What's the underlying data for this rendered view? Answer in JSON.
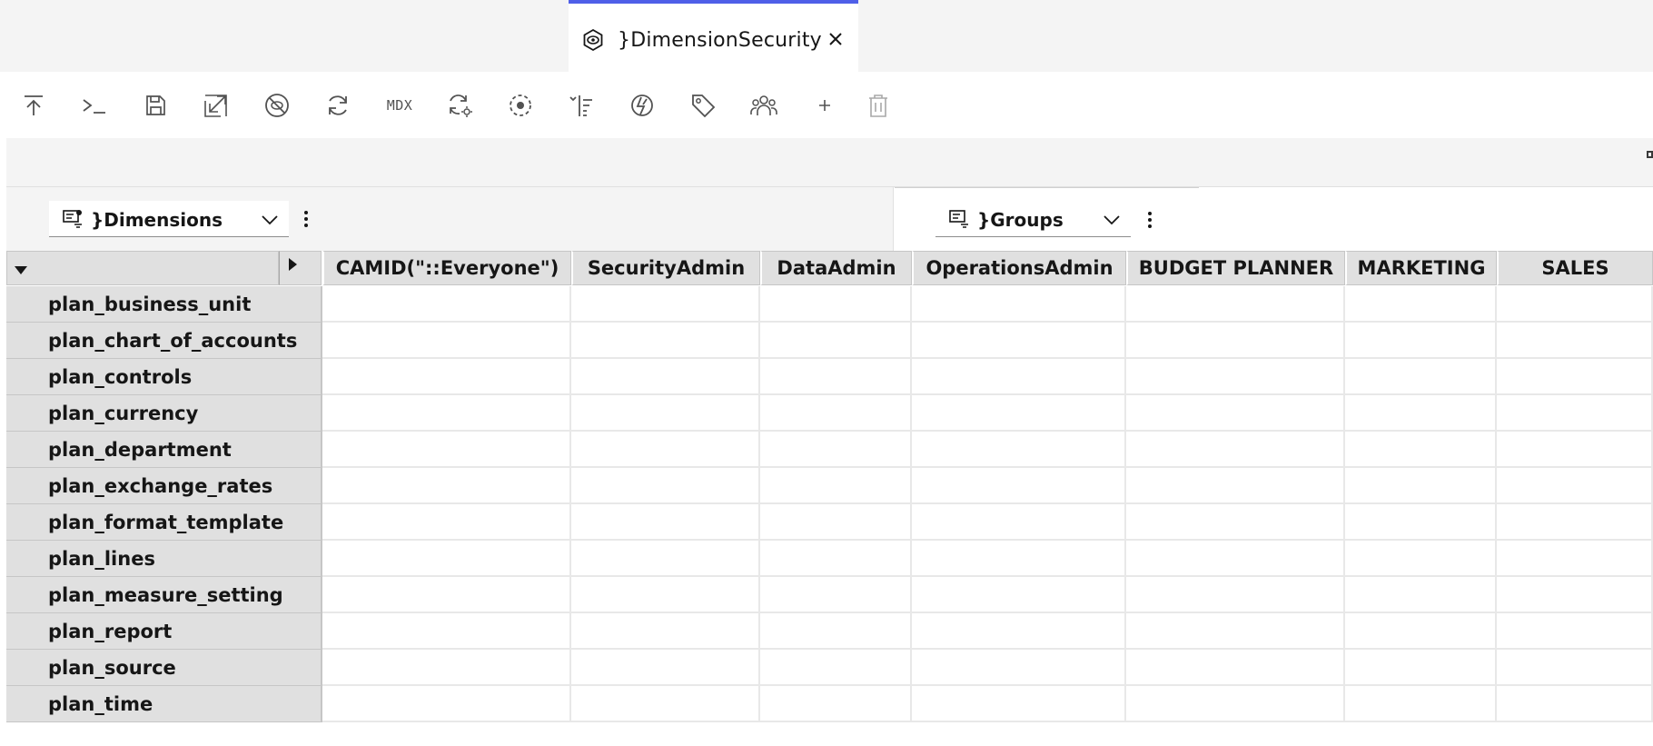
{
  "tab": {
    "title": "}DimensionSecurity",
    "icon": "view-icon",
    "accent_color": "#4f5fe8"
  },
  "toolbar": {
    "items": [
      {
        "name": "publish",
        "icon": "upload-icon"
      },
      {
        "name": "console",
        "icon": "terminal-icon"
      },
      {
        "name": "save",
        "icon": "save-icon"
      },
      {
        "name": "resize",
        "icon": "resize-icon"
      },
      {
        "name": "hide-empty",
        "icon": "no-view-icon"
      },
      {
        "name": "refresh",
        "icon": "refresh-icon"
      },
      {
        "name": "mdx",
        "label": "MDX"
      },
      {
        "name": "auto-refresh",
        "icon": "refresh-settings-icon"
      },
      {
        "name": "focus",
        "icon": "focus-icon"
      },
      {
        "name": "sort",
        "icon": "tree-sort-icon"
      },
      {
        "name": "no-zero",
        "icon": "zero-suppress-icon"
      },
      {
        "name": "tag",
        "icon": "tag-icon"
      },
      {
        "name": "users",
        "icon": "users-icon"
      },
      {
        "name": "add",
        "icon": "plus-icon"
      },
      {
        "name": "delete",
        "icon": "trash-icon"
      }
    ]
  },
  "selectors": {
    "rows": {
      "label": "}Dimensions",
      "icon": "subset-icon"
    },
    "columns": {
      "label": "}Groups",
      "icon": "subset-icon"
    }
  },
  "grid": {
    "columns": [
      "CAMID(\"::Everyone\")",
      "SecurityAdmin",
      "DataAdmin",
      "OperationsAdmin",
      "BUDGET PLANNER",
      "MARKETING",
      "SALES"
    ],
    "rows": [
      "plan_business_unit",
      "plan_chart_of_accounts",
      "plan_controls",
      "plan_currency",
      "plan_department",
      "plan_exchange_rates",
      "plan_format_template",
      "plan_lines",
      "plan_measure_setting",
      "plan_report",
      "plan_source",
      "plan_time"
    ]
  }
}
